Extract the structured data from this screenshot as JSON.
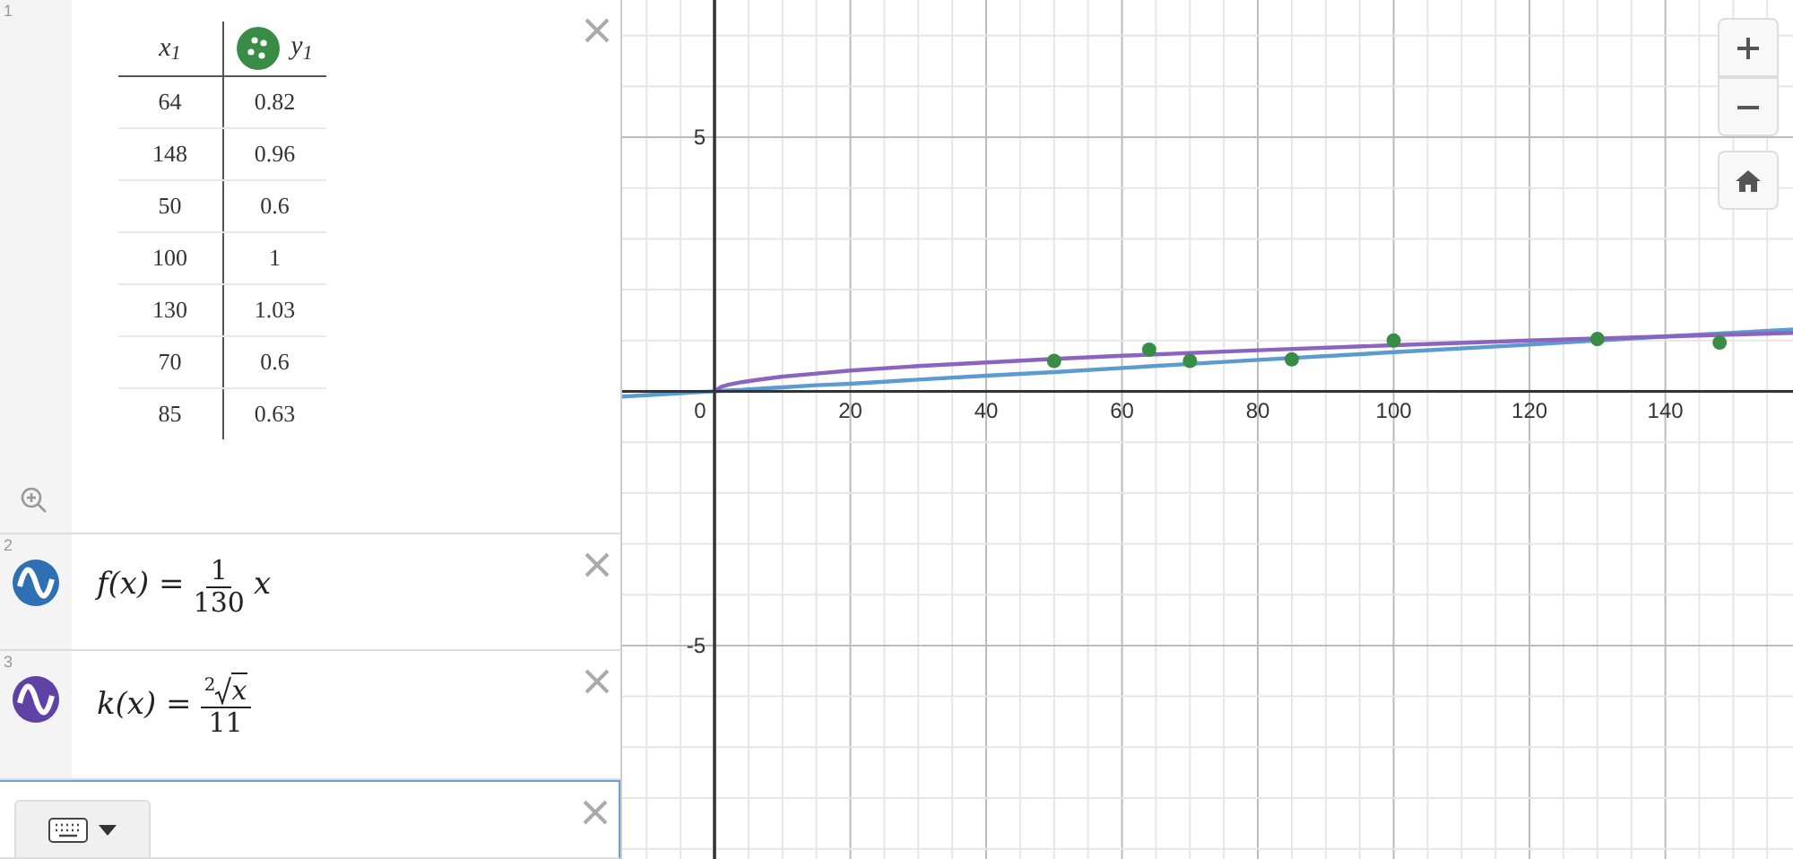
{
  "expressions": [
    {
      "kind": "table",
      "number": "1",
      "color": "#388c46",
      "columns": [
        "x$_{1}$",
        "y$_{1}$"
      ],
      "rows": [
        [
          "64",
          "0.82"
        ],
        [
          "148",
          "0.96"
        ],
        [
          "50",
          "0.6"
        ],
        [
          "100",
          "1"
        ],
        [
          "130",
          "1.03"
        ],
        [
          "70",
          "0.6"
        ],
        [
          "85",
          "0.63"
        ]
      ]
    },
    {
      "kind": "fraction",
      "number": "2",
      "color": "#2d70b3",
      "lhs": "f(x) =",
      "numerator": "1",
      "denominator": "130",
      "trailing": "x"
    },
    {
      "kind": "root_fraction",
      "number": "3",
      "color": "#6042a6",
      "lhs": "k(x) =",
      "root_index": "2",
      "radicand": "x",
      "denominator": "11"
    }
  ],
  "graph": {
    "chart_data": {
      "type": "line",
      "grid": true,
      "xlim": [
        -13.6,
        158.8
      ],
      "ylim": [
        -9.2,
        7.7
      ],
      "xticks": [
        0,
        20,
        40,
        60,
        80,
        100,
        120,
        140
      ],
      "yticks": [
        -5,
        5
      ],
      "x": [
        -13.6,
        0,
        1,
        2,
        4,
        6,
        10,
        15,
        20,
        30,
        40,
        50,
        60,
        80,
        100,
        120,
        140,
        158.8
      ],
      "series": [
        {
          "color": "#5b9bd0",
          "values": [
            -0.1,
            0,
            0.01,
            0.02,
            0.03,
            0.05,
            0.08,
            0.12,
            0.15,
            0.23,
            0.31,
            0.38,
            0.46,
            0.62,
            0.77,
            0.92,
            1.08,
            1.22
          ]
        },
        {
          "color": "#8a64c0",
          "values": [
            null,
            0,
            0.09,
            0.13,
            0.18,
            0.22,
            0.29,
            0.35,
            0.41,
            0.5,
            0.57,
            0.64,
            0.7,
            0.81,
            0.91,
            1,
            1.08,
            1.15
          ]
        }
      ]
    },
    "points": {
      "chart_data": {
        "type": "scatter",
        "xlim": [
          -13.6,
          158.8
        ],
        "ylim": [
          -9.2,
          7.7
        ],
        "x": [
          64,
          148,
          50,
          100,
          130,
          70,
          85
        ],
        "series": [
          {
            "color": "#388c46",
            "values": [
              0.82,
              0.96,
              0.6,
              1,
              1.03,
              0.6,
              0.63
            ]
          }
        ]
      }
    }
  }
}
